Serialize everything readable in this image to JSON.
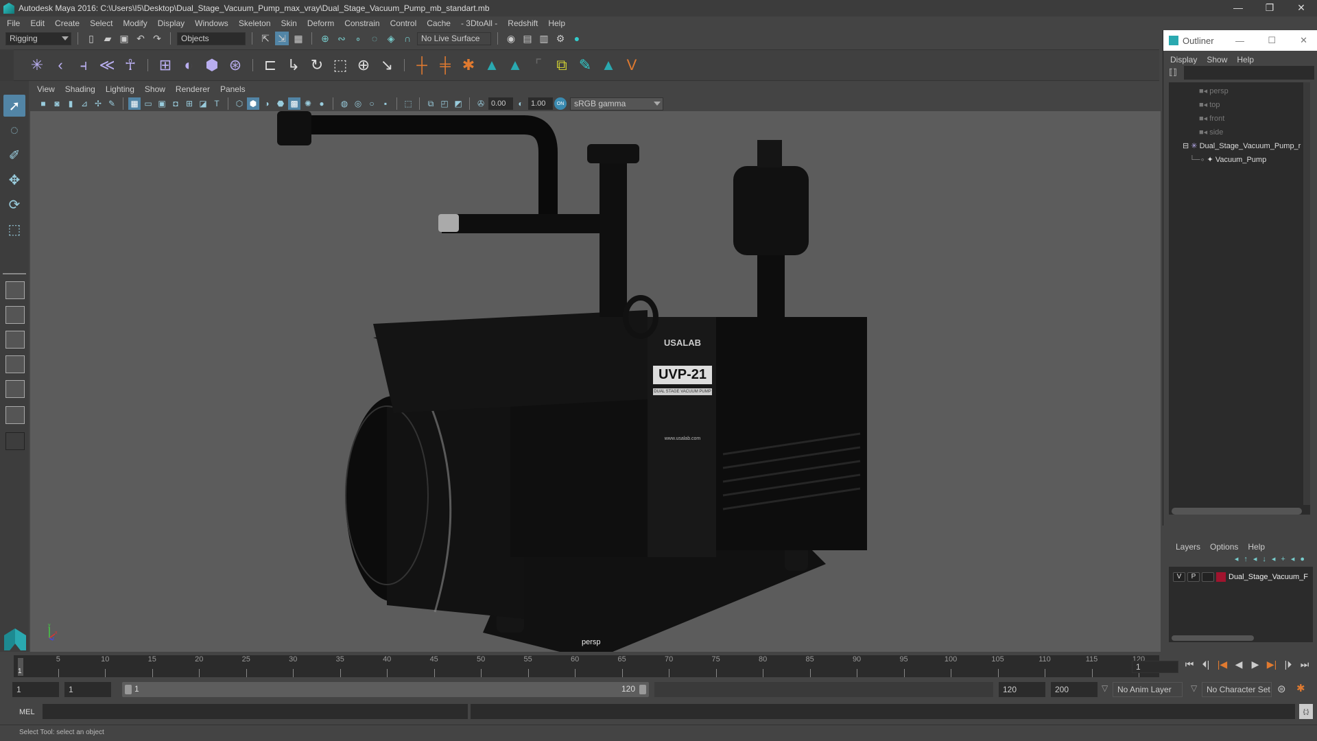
{
  "window": {
    "title": "Autodesk Maya 2016: C:\\Users\\I5\\Desktop\\Dual_Stage_Vacuum_Pump_max_vray\\Dual_Stage_Vacuum_Pump_mb_standart.mb",
    "minimize": "—",
    "restore": "❐",
    "close": "✕"
  },
  "menubar": [
    "File",
    "Edit",
    "Create",
    "Select",
    "Modify",
    "Display",
    "Windows",
    "Skeleton",
    "Skin",
    "Deform",
    "Constrain",
    "Control",
    "Cache",
    "- 3DtoAll -",
    "Redshift",
    "Help"
  ],
  "statusline": {
    "menuset": "Rigging",
    "selection_mask": "Objects",
    "live_surface": "No Live Surface"
  },
  "viewport": {
    "menu": [
      "View",
      "Shading",
      "Lighting",
      "Show",
      "Renderer",
      "Panels"
    ],
    "exposure": "0.00",
    "gamma": "1.00",
    "color_mgmt_toggle": "ON",
    "color_space": "sRGB gamma",
    "camera_label": "persp",
    "axis": {
      "x": "x",
      "y": "y",
      "z": "z"
    },
    "model_label": {
      "brand": "USALAB",
      "model": "UVP-21",
      "subtitle": "DUAL STAGE VACUUM PUMP",
      "website": "www.usalab.com"
    }
  },
  "timeline": {
    "ticks": [
      5,
      10,
      15,
      20,
      25,
      30,
      35,
      40,
      45,
      50,
      55,
      60,
      65,
      70,
      75,
      80,
      85,
      90,
      95,
      100,
      105,
      110,
      115,
      120
    ],
    "min": 1,
    "max": 120,
    "current_marker": "1",
    "current_frame": "1"
  },
  "range": {
    "start_time": "1",
    "playback_start": "1",
    "slider_start": "1",
    "slider_end": "120",
    "playback_end": "120",
    "end_time": "200",
    "anim_layer": "No Anim Layer",
    "character_set": "No Character Set"
  },
  "commandline": {
    "label": "MEL"
  },
  "helpline": {
    "text": "Select Tool: select an object"
  },
  "outliner": {
    "title": "Outliner",
    "menu": [
      "Display",
      "Show",
      "Help"
    ],
    "items": [
      {
        "label": "persp",
        "type": "camera"
      },
      {
        "label": "top",
        "type": "camera"
      },
      {
        "label": "front",
        "type": "camera"
      },
      {
        "label": "side",
        "type": "camera"
      },
      {
        "label": "Dual_Stage_Vacuum_Pump_r",
        "type": "group"
      },
      {
        "label": "Vacuum_Pump",
        "type": "mesh"
      }
    ]
  },
  "layers": {
    "menu": [
      "Layers",
      "Options",
      "Help"
    ],
    "rows": [
      {
        "visible": "V",
        "playback": "P",
        "name": "Dual_Stage_Vacuum_F",
        "color": "#a0142e"
      }
    ]
  },
  "colors": {
    "accent": "#5285a6",
    "shelf_icon": "#b9aef0",
    "maya_teal": "#2aa9b0",
    "anim_orange": "#e07a30"
  }
}
